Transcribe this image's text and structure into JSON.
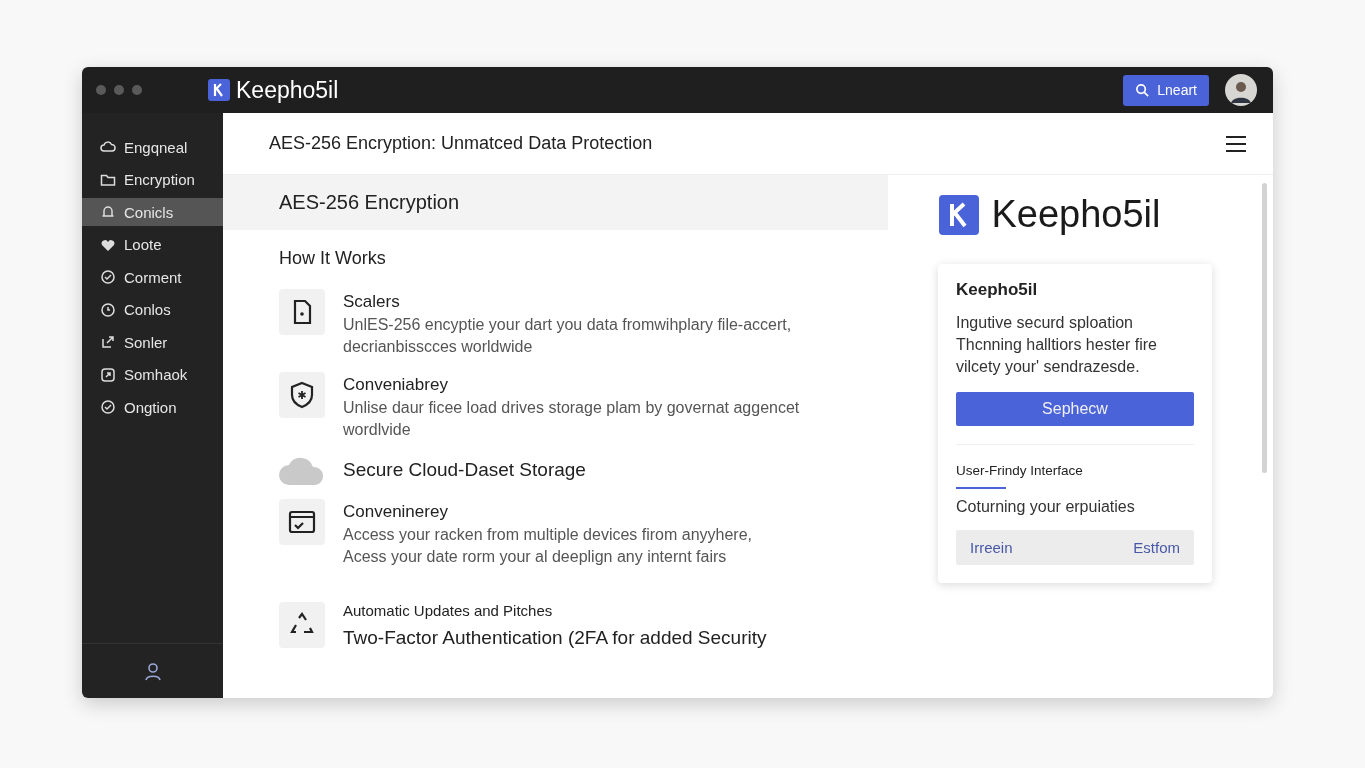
{
  "window": {
    "app_name": "Keepho5il",
    "search_button": "Lneart"
  },
  "sidebar": {
    "items": [
      {
        "label": "Engqneal",
        "selected": false
      },
      {
        "label": "Encryption",
        "selected": false
      },
      {
        "label": "Conicls",
        "selected": true
      },
      {
        "label": "Loote",
        "selected": false
      },
      {
        "label": "Corment",
        "selected": false
      },
      {
        "label": "Conlos",
        "selected": false
      },
      {
        "label": "Sonler",
        "selected": false
      },
      {
        "label": "Somhaok",
        "selected": false
      },
      {
        "label": "Ongtion",
        "selected": false
      }
    ]
  },
  "header": {
    "title": "AES-256 Encryption: Unmatced Data Protection"
  },
  "main": {
    "banner": "AES-256 Encryption",
    "section_title": "How It Works",
    "features": [
      {
        "kind": "standard",
        "title": "Scalers",
        "lines": [
          "UnlES-256 encyptie your dart you data fromwihplary file-accert,",
          "decrianbisscces worldwide"
        ]
      },
      {
        "kind": "standard",
        "title": "Conveniabrey",
        "lines": [
          "Unlise daur ficee load drives storage plam by governat aggencet",
          "wordlvide"
        ]
      },
      {
        "kind": "headline",
        "title": "Secure Cloud-Daset Storage"
      },
      {
        "kind": "standard",
        "title": "Conveninerey",
        "lines": [
          "Access your racken from multiple devices firom anyyhere,",
          "Acess your date rorm your al deeplign any internt fairs"
        ]
      },
      {
        "kind": "stacked",
        "title": "Automatic Updates and Pitches",
        "subtitle": "Two-Factor Authentication (2FA for added Security"
      }
    ]
  },
  "aside": {
    "brand": "Keepho5il",
    "card": {
      "title": "Keepho5il",
      "lines": [
        "Ingutive securd sploation",
        "Thcnning halltiors hester fire",
        "vilcety your' sendrazesde."
      ],
      "button": "Sephecw",
      "tab": {
        "label": "User-Frindy Interface",
        "selected": true
      },
      "text": "Coturning your erpuiaties",
      "actions": [
        "Irreein",
        "Estfom"
      ]
    }
  }
}
